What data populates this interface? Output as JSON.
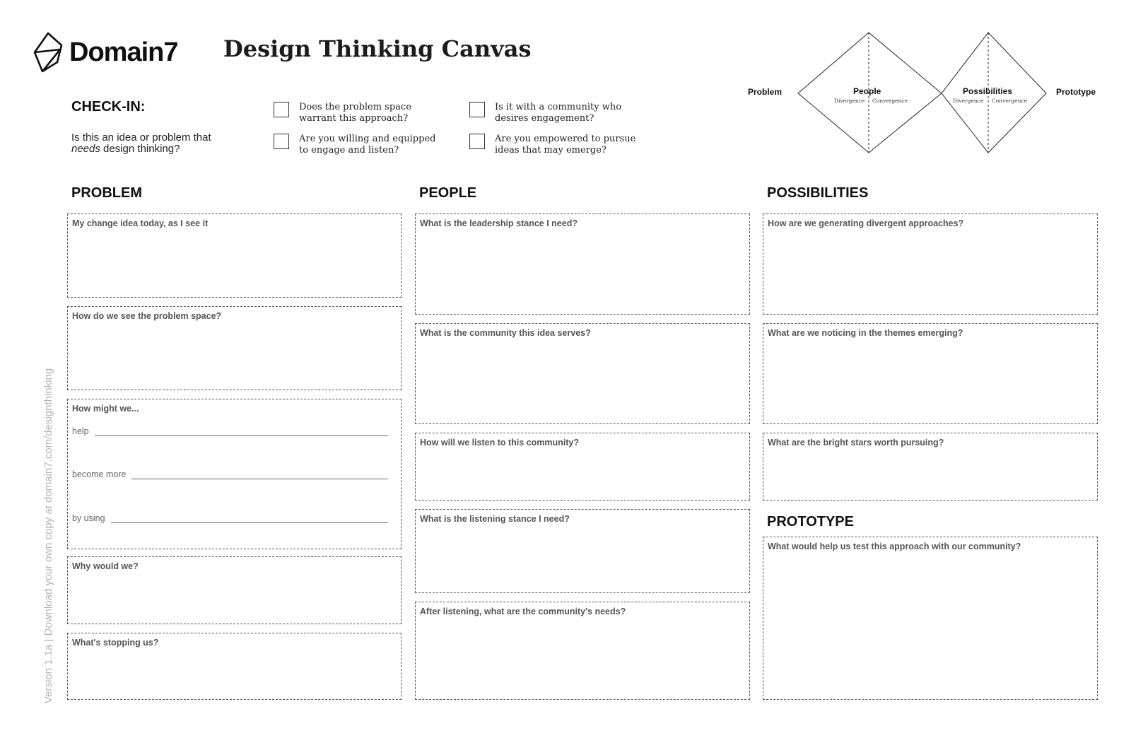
{
  "brand": {
    "logo_text": "Domain7"
  },
  "title": "Design Thinking Canvas",
  "checkin": {
    "title": "CHECK-IN:",
    "question_pre": "Is this an idea or problem that ",
    "question_em": "needs",
    "question_post": " design thinking?",
    "items": [
      {
        "label": "Does the problem space warrant this approach?"
      },
      {
        "label": "Are you willing and equipped to engage and listen?"
      },
      {
        "label": "Is it with a community who desires engagement?"
      },
      {
        "label": "Are you empowered to pursue ideas that may emerge?"
      }
    ]
  },
  "diagram": {
    "left_label": "Problem",
    "diamond1_label": "People",
    "diamond2_label": "Possibilities",
    "right_label": "Prototype",
    "divergence": "Divergence",
    "convergence": "Convergence"
  },
  "problem": {
    "heading": "PROBLEM",
    "boxes": [
      {
        "prompt": "My change idea today, as I see it"
      },
      {
        "prompt": "How do we see the problem space?"
      },
      {
        "prompt": "How might we..."
      },
      {
        "prompt": "Why would we?"
      },
      {
        "prompt": "What's stopping us?"
      }
    ],
    "hmw": {
      "help": "help",
      "become_more": "become more",
      "by_using": "by using"
    }
  },
  "people": {
    "heading": "PEOPLE",
    "boxes": [
      {
        "prompt": "What is the leadership stance I need?"
      },
      {
        "prompt": "What is the community this idea serves?"
      },
      {
        "prompt": "How will we listen to this community?"
      },
      {
        "prompt": "What is the listening stance I need?"
      },
      {
        "prompt": "After listening, what are the community's needs?"
      }
    ]
  },
  "possibilities": {
    "heading": "POSSIBILITIES",
    "boxes": [
      {
        "prompt": "How are we generating divergent approaches?"
      },
      {
        "prompt": "What are we noticing in the themes emerging?"
      },
      {
        "prompt": "What are the bright stars worth pursuing?"
      }
    ]
  },
  "prototype": {
    "heading": "PROTOTYPE",
    "boxes": [
      {
        "prompt": "What would help us test this approach with our community?"
      }
    ]
  },
  "footer": {
    "side_text": "Version 1.1a | Download your own copy at domain7.com/designthinking"
  }
}
